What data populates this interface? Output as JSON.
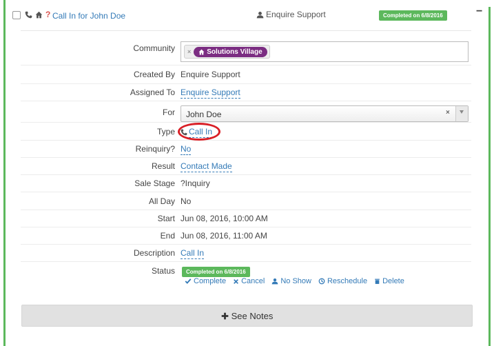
{
  "header": {
    "title": "Call In for John Doe",
    "owner": "Enquire Support",
    "status_badge": "Completed on 6/8/2016",
    "collapse_symbol": "−",
    "question_mark": "?"
  },
  "fields": {
    "community": {
      "label": "Community",
      "tag": "Solutions Village",
      "tag_remove": "×"
    },
    "created_by": {
      "label": "Created By",
      "value": "Enquire Support"
    },
    "assigned_to": {
      "label": "Assigned To",
      "value": "Enquire Support"
    },
    "for": {
      "label": "For",
      "value": "John Doe",
      "clear": "×"
    },
    "type": {
      "label": "Type",
      "value": "Call In"
    },
    "reinquiry": {
      "label": "Reinquiry?",
      "value": "No"
    },
    "result": {
      "label": "Result",
      "value": "Contact Made"
    },
    "sale_stage": {
      "label": "Sale Stage",
      "value": "?Inquiry"
    },
    "all_day": {
      "label": "All Day",
      "value": "No"
    },
    "start": {
      "label": "Start",
      "value": "Jun 08, 2016, 10:00 AM"
    },
    "end": {
      "label": "End",
      "value": "Jun 08, 2016, 11:00 AM"
    },
    "description": {
      "label": "Description",
      "value": "Call In"
    },
    "status": {
      "label": "Status",
      "badge": "Completed on 6/8/2016"
    }
  },
  "actions": {
    "complete": "Complete",
    "cancel": "Cancel",
    "no_show": "No Show",
    "reschedule": "Reschedule",
    "delete": "Delete"
  },
  "see_notes": {
    "label": "See Notes"
  },
  "icons": [
    "phone-icon",
    "home-icon",
    "user-icon",
    "check-icon",
    "x-icon",
    "clock-icon",
    "trash-icon",
    "plus-icon"
  ],
  "colors": {
    "accent_green": "#5cb85c",
    "link_blue": "#337ab7",
    "tag_purple": "#7b2d82",
    "highlight_red": "#d91f26"
  }
}
